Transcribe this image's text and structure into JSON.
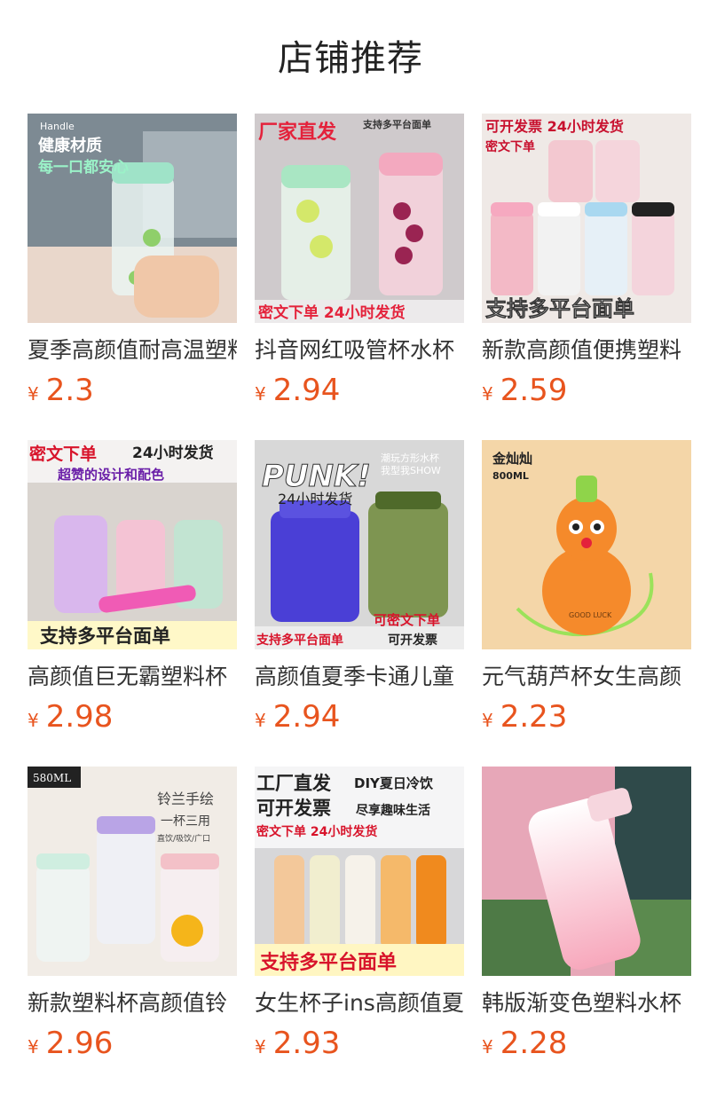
{
  "header": {
    "title": "店铺推荐"
  },
  "currency_symbol": "¥",
  "products": [
    {
      "name": "夏季高颜值耐高温塑料",
      "price": "2.3",
      "image": {
        "bg": "#7d8a93",
        "accent": "#9fe3c8",
        "texts": [
          "Handle",
          "健康材质",
          "每一口都安心"
        ]
      }
    },
    {
      "name": "抖音网红吸管杯水杯",
      "price": "2.94",
      "image": {
        "bg": "#c9c4c6",
        "accent": "#f3a9bf",
        "texts": [
          "厂家直发",
          "支持多平台面单",
          "密文下单 24小时发货"
        ]
      }
    },
    {
      "name": "新款高颜值便携塑料",
      "price": "2.59",
      "image": {
        "bg": "#efe9e6",
        "accent": "#c8102e",
        "texts": [
          "可开发票 24小时发货",
          "密文下单",
          "支持多平台面单"
        ]
      }
    },
    {
      "name": "高颜值巨无霸塑料杯",
      "price": "2.98",
      "image": {
        "bg": "#d9d4cf",
        "accent": "#f05bb5",
        "texts": [
          "密文下单",
          "24小时发货",
          "超赞的设计和配色",
          "支持多平台面单"
        ]
      }
    },
    {
      "name": "高颜值夏季卡通儿童",
      "price": "2.94",
      "image": {
        "bg": "#d8d8d8",
        "accent": "#3b2fd6",
        "texts": [
          "PUNK!",
          "潮玩方形水杯",
          "我型我SHOW",
          "24小时发货",
          "可密文下单",
          "支持多平台面单",
          "可开发票"
        ]
      }
    },
    {
      "name": "元气葫芦杯女生高颜",
      "price": "2.23",
      "image": {
        "bg": "#f4d6a8",
        "accent": "#f58a2b",
        "texts": [
          "金灿灿",
          "800ML",
          "GOOD LUCK"
        ]
      }
    },
    {
      "name": "新款塑料杯高颜值铃",
      "price": "2.96",
      "image": {
        "bg": "#f1ece6",
        "accent": "#b9a4e6",
        "texts": [
          "580ML",
          "铃兰手绘",
          "一杯三用",
          "直饮/吸饮/广口"
        ]
      }
    },
    {
      "name": "女生杯子ins高颜值夏",
      "price": "2.93",
      "image": {
        "bg": "#d7d7d9",
        "accent": "#f08a1e",
        "texts": [
          "工厂直发",
          "DIY夏日冷饮",
          "可开发票",
          "尽享趣味生活",
          "密文下单 24小时发货",
          "支持多平台面单"
        ]
      }
    },
    {
      "name": "韩版渐变色塑料水杯",
      "price": "2.28",
      "image": {
        "bg": "#e7a7b8",
        "accent": "#f7c2cf",
        "texts": []
      }
    }
  ]
}
